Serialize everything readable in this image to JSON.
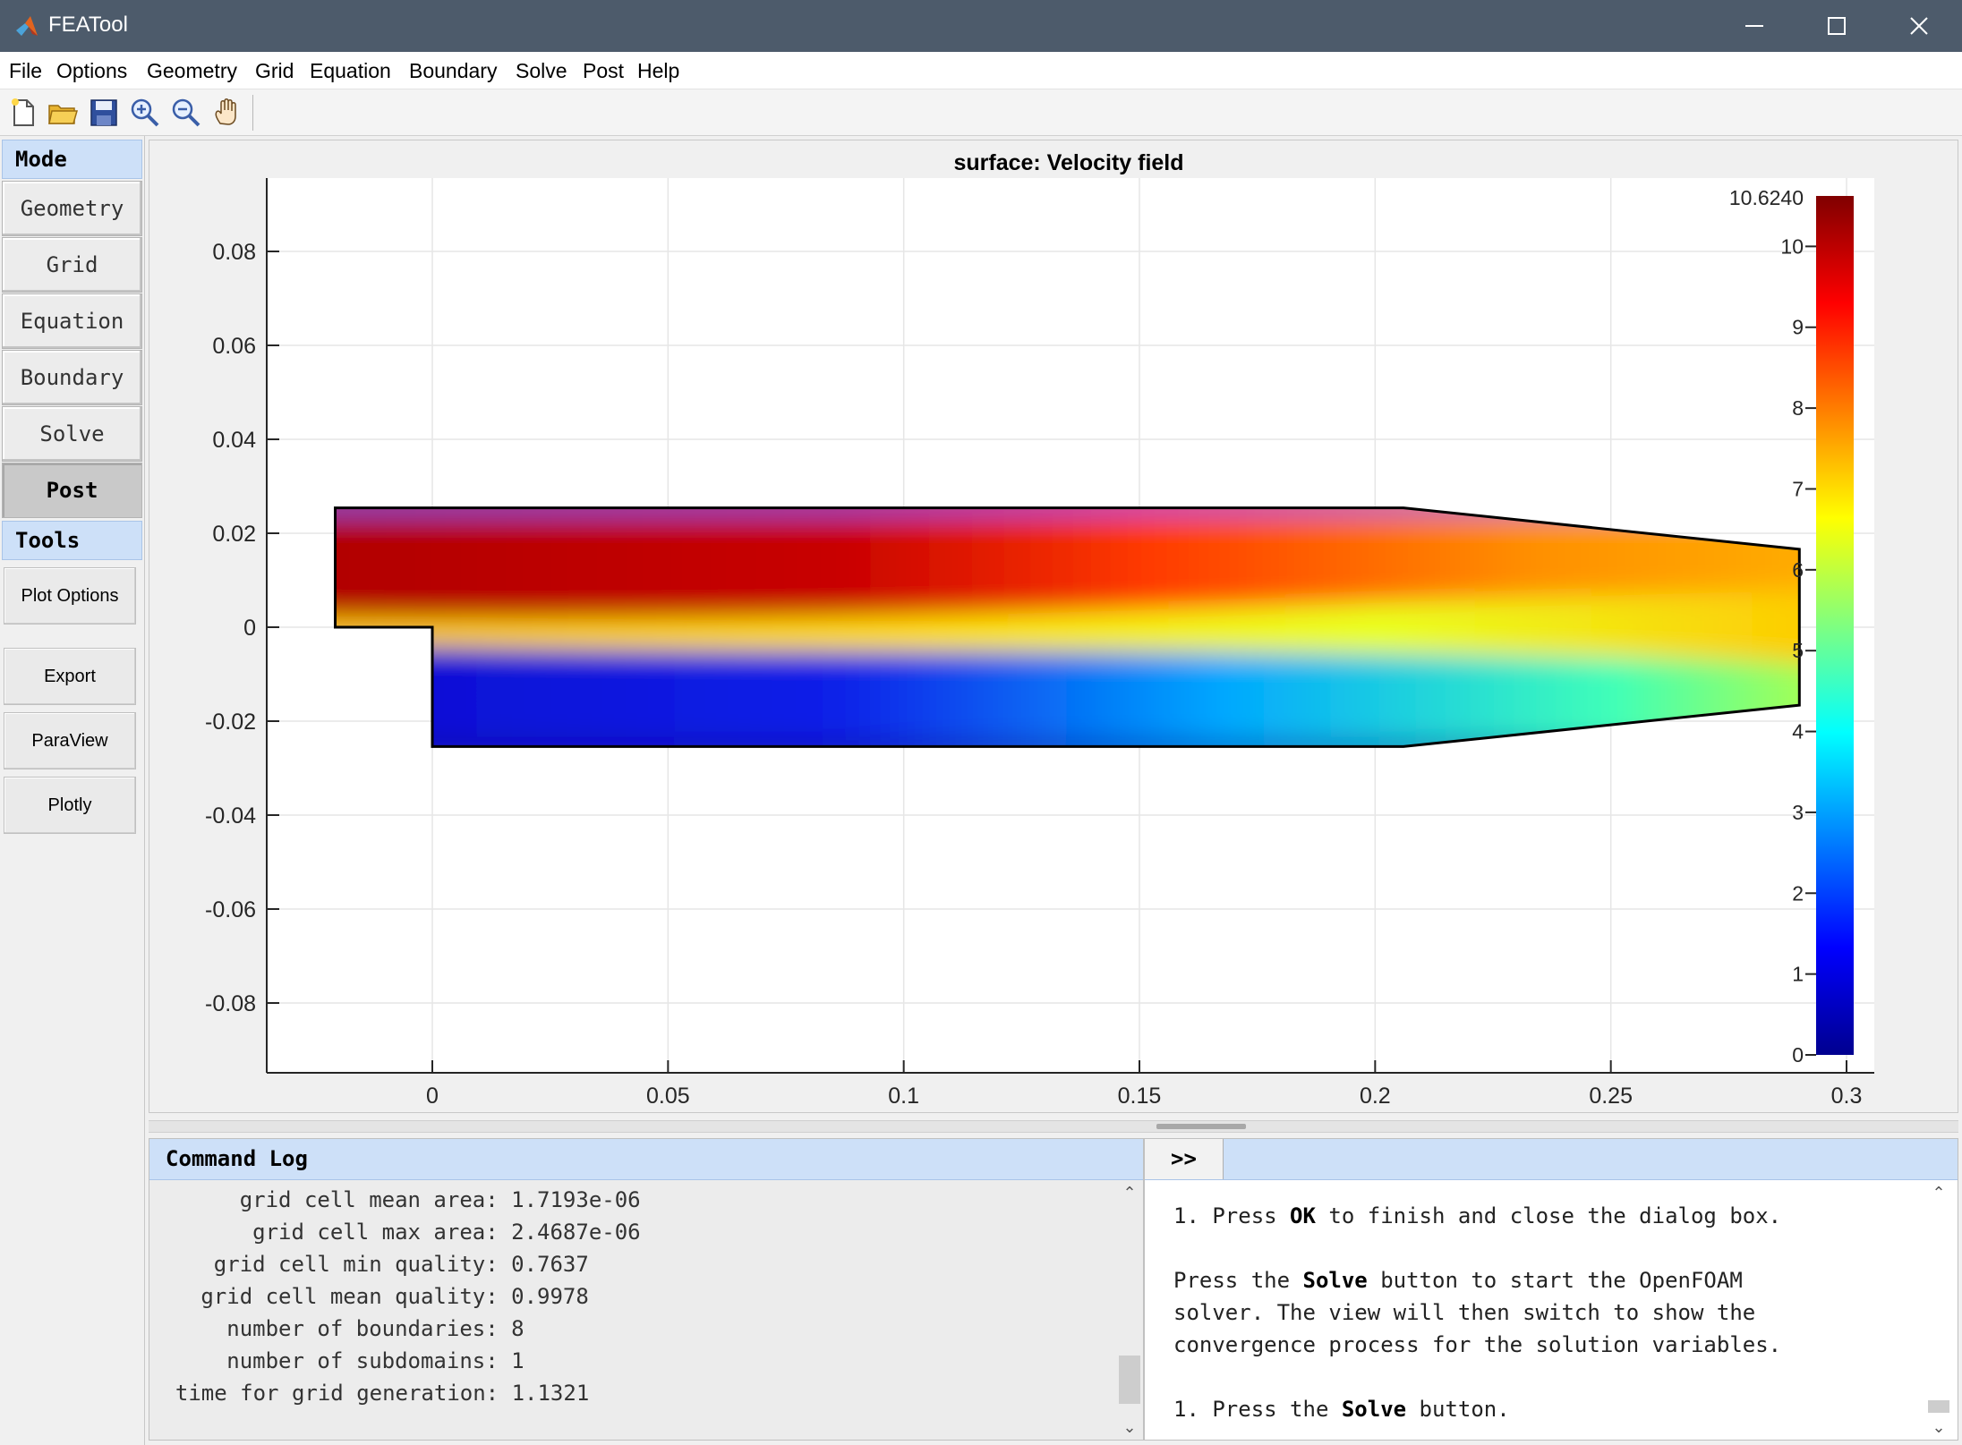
{
  "window": {
    "title": "FEATool",
    "icon": "matlab-logo-icon"
  },
  "menu": [
    "File",
    "Options",
    "Geometry",
    "Grid",
    "Equation",
    "Boundary",
    "Solve",
    "Post",
    "Help"
  ],
  "toolbar": {
    "icons": [
      "new-file-icon",
      "open-folder-icon",
      "save-icon",
      "zoom-in-icon",
      "zoom-out-icon",
      "pan-hand-icon"
    ]
  },
  "left_panel": {
    "mode_label": "Mode",
    "modes": [
      "Geometry",
      "Grid",
      "Equation",
      "Boundary",
      "Solve",
      "Post"
    ],
    "active_mode": "Post",
    "tools_label": "Tools",
    "tools": [
      "Plot Options",
      "Export",
      "ParaView",
      "Plotly"
    ]
  },
  "plot": {
    "title": "surface: Velocity field",
    "colormap": "jet",
    "colors": {
      "domain_edge": "#000000",
      "grid": "#e6e6e6",
      "low": "#00008f",
      "high": "#800000"
    }
  },
  "chart_data": {
    "type": "heatmap",
    "title": "surface: Velocity field",
    "field": "Velocity field",
    "xlim": [
      -0.036,
      0.306
    ],
    "ylim": [
      -0.095,
      0.095
    ],
    "xticks": [
      0,
      0.05,
      0.1,
      0.15,
      0.2,
      0.25,
      0.3
    ],
    "xtick_labels": [
      "0",
      "0.05",
      "0.1",
      "0.15",
      "0.2",
      "0.25",
      "0.3"
    ],
    "yticks": [
      0.08,
      0.06,
      0.04,
      0.02,
      0,
      -0.02,
      -0.04,
      -0.06,
      -0.08
    ],
    "ytick_labels": [
      "0.08",
      "0.06",
      "0.04",
      "0.02",
      "0",
      "-0.02",
      "-0.04",
      "-0.06",
      "-0.08"
    ],
    "grid": true,
    "domain_outline": [
      [
        -0.0206,
        0.0254
      ],
      [
        0.206,
        0.0254
      ],
      [
        0.29,
        0.0166
      ],
      [
        0.29,
        -0.0166
      ],
      [
        0.206,
        -0.0254
      ],
      [
        0,
        -0.0254
      ],
      [
        0,
        0
      ],
      [
        -0.0206,
        0
      ]
    ],
    "colorbar": {
      "min": 0,
      "max": 10.624,
      "max_label": "10.6240",
      "ticks": [
        0,
        1,
        2,
        3,
        4,
        5,
        6,
        7,
        8,
        9,
        10
      ],
      "tick_labels": [
        "0",
        "1",
        "2",
        "3",
        "4",
        "5",
        "6",
        "7",
        "8",
        "9",
        "10"
      ],
      "placement": "right"
    }
  },
  "command_log": {
    "header": "Command Log",
    "lines": [
      "      grid cell mean area: 1.7193e-06",
      "       grid cell max area: 2.4687e-06",
      "    grid cell min quality: 0.7637",
      "   grid cell mean quality: 0.9978",
      "     number of boundaries: 8",
      "     number of subdomains: 1",
      "  time for grid generation: 1.1321"
    ]
  },
  "help": {
    "expand_label": ">>",
    "lines": [
      [
        {
          "t": "1. Press "
        },
        {
          "t": "OK",
          "b": true
        },
        {
          "t": " to finish and close the dialog box."
        }
      ],
      [],
      [
        {
          "t": "Press the "
        },
        {
          "t": "Solve",
          "b": true
        },
        {
          "t": " button to start the OpenFOAM"
        }
      ],
      [
        {
          "t": "solver. The view will then switch to show the"
        }
      ],
      [
        {
          "t": "convergence process for the solution variables."
        }
      ],
      [],
      [
        {
          "t": "1. Press the "
        },
        {
          "t": "Solve",
          "b": true
        },
        {
          "t": " button."
        }
      ]
    ]
  }
}
